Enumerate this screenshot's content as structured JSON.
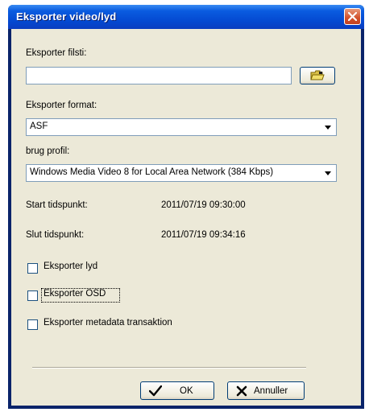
{
  "dialog": {
    "title": "Eksporter video/lyd",
    "close_icon": "close-icon"
  },
  "export_path": {
    "label": "Eksporter filsti:",
    "value": "",
    "browse_icon": "folder-open-icon"
  },
  "export_format": {
    "label": "Eksporter format:",
    "selected": "ASF"
  },
  "profile": {
    "label": "brug profil:",
    "selected": "Windows Media Video 8 for Local Area Network (384 Kbps)"
  },
  "times": {
    "start_label": "Start tidspunkt:",
    "start_value": "2011/07/19 09:30:00",
    "end_label": "Slut tidspunkt:",
    "end_value": "2011/07/19 09:34:16"
  },
  "options": [
    {
      "label": "Eksporter lyd",
      "checked": false
    },
    {
      "label": "Eksporter OSD",
      "checked": false
    },
    {
      "label": "Eksporter metadata transaktion",
      "checked": false
    }
  ],
  "buttons": {
    "ok_label": "OK",
    "ok_icon": "checkmark-icon",
    "cancel_label": "Annuller",
    "cancel_icon": "x-icon"
  },
  "colors": {
    "titlebar": "#0448d0",
    "client": "#ece9d8",
    "close": "#d2502a"
  }
}
